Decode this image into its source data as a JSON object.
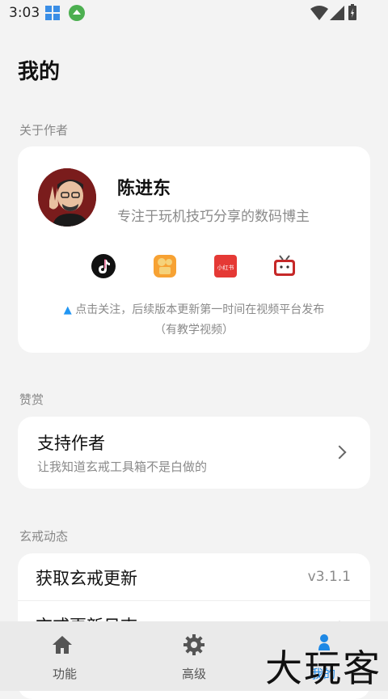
{
  "status_bar": {
    "time": "3:03"
  },
  "page": {
    "title": "我的"
  },
  "sections": {
    "about": "关于作者",
    "reward": "赞赏",
    "news": "玄戒动态"
  },
  "author": {
    "name": "陈进东",
    "description": "专注于玩机技巧分享的数码博主",
    "social_icons": [
      "tiktok-icon",
      "kuaishou-icon",
      "xiaohongshu-icon",
      "bilibili-icon"
    ],
    "xiaohongshu_label": "小红书",
    "follow_tip_line1": "点击关注，后续版本更新第一时间在视频平台发布",
    "follow_tip_line2": "（有教学视频）"
  },
  "support": {
    "title": "支持作者",
    "subtitle": "让我知道玄戒工具箱不是白做的"
  },
  "updates": {
    "get_update": "获取玄戒更新",
    "version": "v3.1.1",
    "changelog": "玄戒更新日志"
  },
  "bottom_nav": {
    "items": [
      {
        "label": "功能",
        "icon": "home-icon"
      },
      {
        "label": "高级",
        "icon": "gear-icon"
      },
      {
        "label": "我的",
        "icon": "person-icon"
      }
    ],
    "active_color": "#1e88e5"
  },
  "watermark": "大玩客"
}
